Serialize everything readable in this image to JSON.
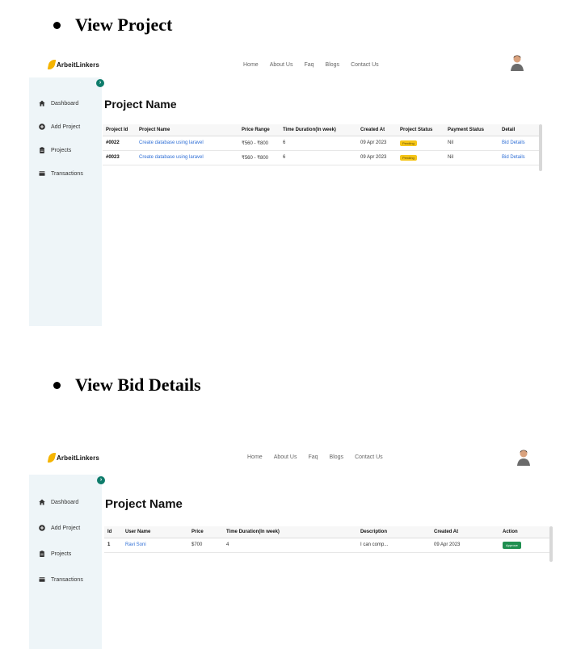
{
  "doc": {
    "heading1": "View Project",
    "heading2": "View Bid Details"
  },
  "brand": {
    "name": "ArbeitLinkers",
    "color": "#f5b400"
  },
  "nav": {
    "home": "Home",
    "about": "About Us",
    "faq": "Faq",
    "blogs": "Blogs",
    "contact": "Contact Us"
  },
  "sidebar": {
    "items": [
      {
        "label": "Dashboard",
        "icon": "home-icon"
      },
      {
        "label": "Add Project",
        "icon": "plus-circle-icon"
      },
      {
        "label": "Projects",
        "icon": "clipboard-icon"
      },
      {
        "label": "Transactions",
        "icon": "wallet-icon"
      }
    ]
  },
  "project_view": {
    "title": "Project Name",
    "columns": [
      "Project Id",
      "Project Name",
      "Price Range",
      "Time Duration(In week)",
      "Created At",
      "Project Status",
      "Payment Status",
      "Detail"
    ],
    "rows": [
      {
        "id": "#0022",
        "name": "Create database using laravel",
        "price": "₹560 - ₹800",
        "duration": "6",
        "created": "09 Apr 2023",
        "status": "Pending",
        "payment": "Nil",
        "detail": "Bid Details"
      },
      {
        "id": "#0023",
        "name": "Create database using laravel",
        "price": "₹560 - ₹800",
        "duration": "6",
        "created": "09 Apr 2023",
        "status": "Pending",
        "payment": "Nil",
        "detail": "Bid Details"
      }
    ]
  },
  "bid_view": {
    "title": "Project Name",
    "columns": [
      "Id",
      "User Name",
      "Price",
      "Time Duration(In week)",
      "Description",
      "Created At",
      "Action"
    ],
    "rows": [
      {
        "id": "1",
        "user": "Ravi Soni",
        "price": "$700",
        "duration": "4",
        "description": "I can comp...",
        "created": "09 Apr 2023",
        "action": "Approve"
      }
    ]
  },
  "colors": {
    "sidebar": "#eef5f8",
    "accent": "#0e7c6b",
    "link": "#2f6fd6",
    "pending": "#f5c518",
    "approve": "#1f8f50"
  }
}
